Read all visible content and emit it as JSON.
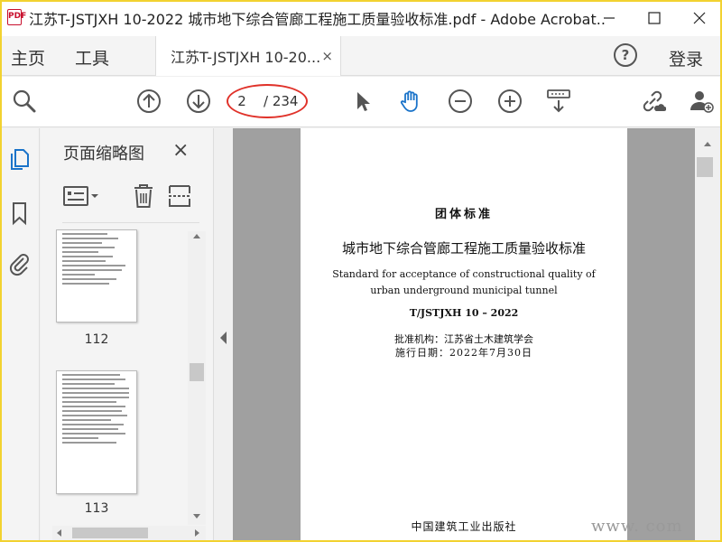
{
  "window": {
    "title": "江苏T-JSTJXH 10-2022 城市地下综合管廊工程施工质量验收标准.pdf - Adobe Acrobat...",
    "app_icon_label": "PDF"
  },
  "menu": {
    "home": "主页",
    "tools": "工具",
    "login": "登录",
    "help_label": "?"
  },
  "tab": {
    "label": "江苏T-JSTJXH 10-20...",
    "close": "×"
  },
  "toolbar": {
    "current_page": "2",
    "total_pages": "/ 234"
  },
  "thumbnail_panel": {
    "title": "页面缩略图",
    "close": "×",
    "thumbnails": [
      {
        "page_number": "112"
      },
      {
        "page_number": "113"
      }
    ]
  },
  "document": {
    "category": "团体标准",
    "title_cn": "城市地下综合管廊工程施工质量验收标准",
    "title_en_line1": "Standard for acceptance of constructional quality of",
    "title_en_line2": "urban underground municipal tunnel",
    "code": "T/JSTJXH 10 – 2022",
    "approval": "批准机构：江苏省土木建筑学会",
    "effective": "施行日期：2022年7月30日",
    "publisher": "中国建筑工业出版社"
  },
  "watermark": "www.      com",
  "colors": {
    "accent_blue": "#1a73c9",
    "annotation_red": "#e0322a",
    "frame_yellow": "#f2d230"
  }
}
